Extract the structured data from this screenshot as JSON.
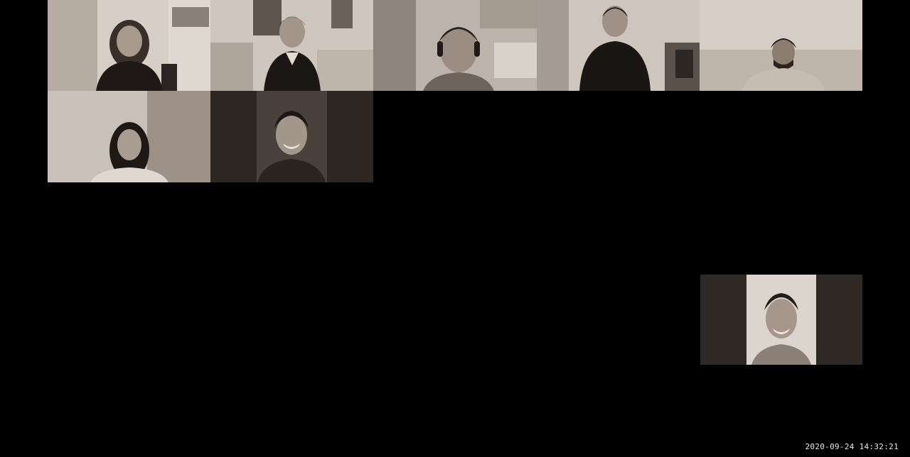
{
  "meeting": {
    "timestamp": "2020-09-24 14:32:21"
  },
  "participants": [
    {
      "id": "p1"
    },
    {
      "id": "p2"
    },
    {
      "id": "p3"
    },
    {
      "id": "p4"
    },
    {
      "id": "p5"
    },
    {
      "id": "p6"
    },
    {
      "id": "p7"
    }
  ],
  "self_view": {
    "id": "self"
  },
  "colors": {
    "background": "#000000",
    "tile_light": "#cfc6bc",
    "tile_mid": "#9a8e84",
    "tile_dark": "#3b3430",
    "skin": "#a8998c",
    "hair": "#1f1a18",
    "shirt": "#151210"
  }
}
